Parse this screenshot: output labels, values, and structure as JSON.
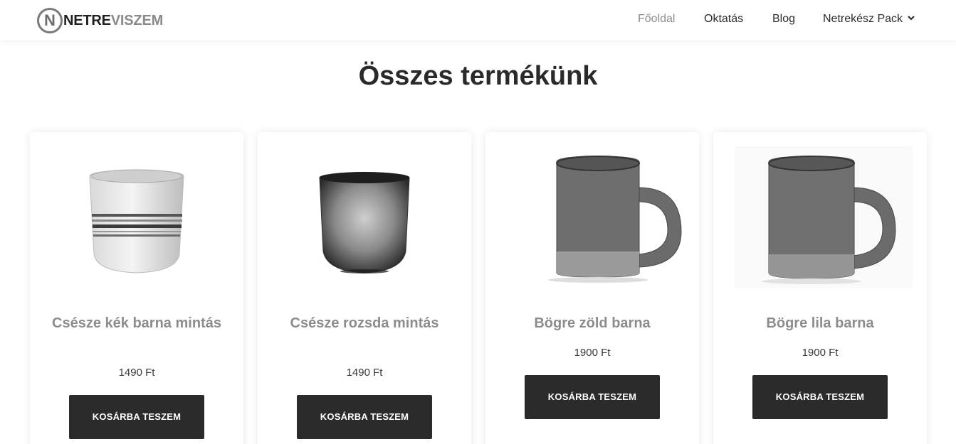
{
  "brand": {
    "part1": "NETRE",
    "part2": "VISZEM",
    "mark": "N"
  },
  "nav": {
    "home": "Főoldal",
    "course": "Oktatás",
    "blog": "Blog",
    "pack": "Netrekész Pack"
  },
  "page_title": "Összes termékünk",
  "products": [
    {
      "name": "Csésze kék barna mintás",
      "price": "1490 Ft",
      "button": "KOSÁRBA TESZEM"
    },
    {
      "name": "Csésze rozsda mintás",
      "price": "1490 Ft",
      "button": "KOSÁRBA TESZEM"
    },
    {
      "name": "Bögre zöld barna",
      "price": "1900 Ft",
      "button": "KOSÁRBA TESZEM"
    },
    {
      "name": "Bögre lila barna",
      "price": "1900 Ft",
      "button": "KOSÁRBA TESZEM"
    }
  ],
  "colors": {
    "accent_dark": "#2b2b2b",
    "nav_active": "#8d8d8d",
    "product_name": "#8c8c8c"
  }
}
